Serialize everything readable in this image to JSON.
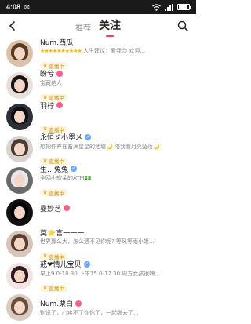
{
  "status_bar": {
    "time": "4:08",
    "notification": "✉"
  },
  "nav": {
    "tab_recommend": "推荐",
    "tab_follow": "关注"
  },
  "tag_label": "直播中",
  "users": [
    {
      "name": "Num.西瓜",
      "signature": "人生建议：爱我😊 欢迎...",
      "stars": "★★★★★★★★★★",
      "has_verify": false,
      "has_vip": false,
      "has_tag": true,
      "avatar_bg": "#d9c2a7",
      "avatar_hair": "#5a3a22"
    },
    {
      "name": "盼兮",
      "signature": "宝藏达人",
      "stars": "",
      "has_verify": false,
      "has_vip": true,
      "has_tag": true,
      "avatar_bg": "#e9e0dc",
      "avatar_hair": "#1d1414"
    },
    {
      "name": "羽柠",
      "signature": "",
      "stars": "",
      "has_verify": false,
      "has_vip": true,
      "has_tag": true,
      "avatar_bg": "#2c2f36",
      "avatar_hair": "#0e0f12"
    },
    {
      "name": "永恒ゞ小墨メ",
      "signature": "想把你养在蓄满星星的池塘🌙 陪我看月亮坠落🌙",
      "stars": "",
      "has_verify": true,
      "has_vip": false,
      "has_tag": true,
      "avatar_bg": "#d8d3cf",
      "avatar_hair": "#4a3b33"
    },
    {
      "name": "生…兔兔",
      "signature": "全网小寂朵的ATM💵",
      "stars": "",
      "has_verify": true,
      "has_vip": false,
      "has_tag": true,
      "avatar_bg": "#6a6a6a",
      "avatar_hair": "#e9e9e9"
    },
    {
      "name": "曼妙艺",
      "signature": "",
      "stars": "",
      "has_verify": false,
      "has_vip": true,
      "has_tag": false,
      "avatar_bg": "#111111",
      "avatar_hair": "#000000"
    },
    {
      "name": "莫⭐言一一一",
      "signature": "世界那么大，怎么遇不见你呢? 等风等雨小姐...",
      "stars": "",
      "has_verify": false,
      "has_vip": false,
      "has_tag": true,
      "avatar_bg": "#d6c5b8",
      "avatar_hair": "#5b3f30"
    },
    {
      "name": "戒❤情儿宝贝",
      "signature": "早上9.0-10.30 下午15.0-17.30 周方女孩很嗨...",
      "stars": "",
      "has_verify": true,
      "has_vip": false,
      "has_tag": true,
      "avatar_bg": "#f2e4e4",
      "avatar_hair": "#2d1d1d"
    },
    {
      "name": "Num.栗白",
      "signature": "别说了，心疼不了你你了，一起哪去了...",
      "stars": "",
      "has_verify": false,
      "has_vip": true,
      "has_tag": false,
      "avatar_bg": "#d8ccc2",
      "avatar_hair": "#6b4e3a"
    }
  ]
}
